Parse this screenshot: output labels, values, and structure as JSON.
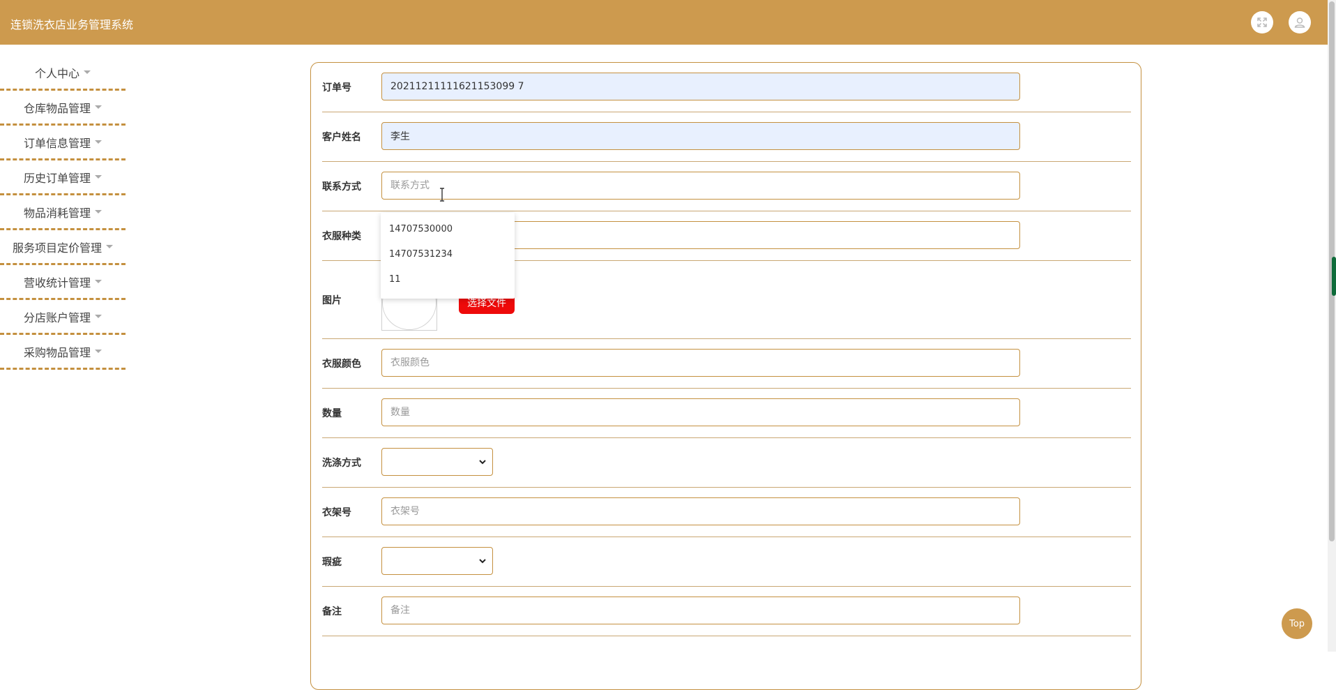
{
  "header": {
    "title": "连锁洗衣店业务管理系统",
    "fullscreen_icon": "expand-arrows-icon",
    "user_icon": "user-icon"
  },
  "sidebar": {
    "items": [
      {
        "label": "个人中心"
      },
      {
        "label": "仓库物品管理"
      },
      {
        "label": "订单信息管理"
      },
      {
        "label": "历史订单管理"
      },
      {
        "label": "物品消耗管理"
      },
      {
        "label": "服务项目定价管理"
      },
      {
        "label": "营收统计管理"
      },
      {
        "label": "分店账户管理"
      },
      {
        "label": "采购物品管理"
      }
    ]
  },
  "form": {
    "order_no": {
      "label": "订单号",
      "value": "20211211111621153099 7"
    },
    "customer_name": {
      "label": "客户姓名",
      "value": "李生"
    },
    "contact": {
      "label": "联系方式",
      "placeholder": "联系方式"
    },
    "clothes_type": {
      "label": "衣服种类"
    },
    "image": {
      "label": "图片",
      "button": "选择文件"
    },
    "clothes_color": {
      "label": "衣服颜色",
      "placeholder": "衣服颜色"
    },
    "quantity": {
      "label": "数量",
      "placeholder": "数量"
    },
    "wash_method": {
      "label": "洗涤方式"
    },
    "hanger_no": {
      "label": "衣架号",
      "placeholder": "衣架号"
    },
    "defect": {
      "label": "瑕疵"
    },
    "remark": {
      "label": "备注",
      "placeholder": "备注"
    }
  },
  "autocomplete": {
    "options": [
      "14707530000",
      "14707531234",
      "11"
    ]
  },
  "top_button": {
    "label": "Top"
  },
  "colors": {
    "header": "#cd9a4e",
    "accent_border": "#c4903f",
    "choose_button": "#ee0a0a",
    "autofill_bg": "#e8f0fe"
  }
}
